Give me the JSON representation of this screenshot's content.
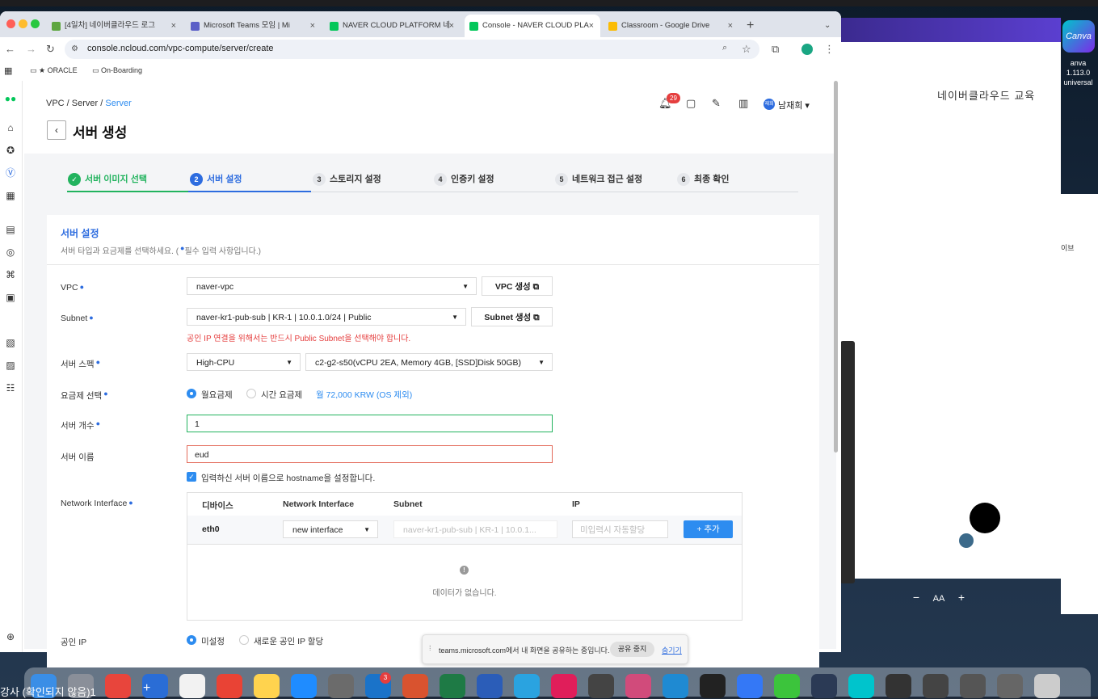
{
  "browser": {
    "tabs": [
      {
        "label": "[4일차] 네이버클라우드 로그",
        "color": "#5ea640"
      },
      {
        "label": "Microsoft Teams 모임 | Mi",
        "color": "#5b5fc7"
      },
      {
        "label": "NAVER CLOUD PLATFORM 네",
        "color": "#03c75a"
      },
      {
        "label": "Console - NAVER CLOUD PLA",
        "color": "#03c75a"
      },
      {
        "label": "Classroom - Google Drive",
        "color": "#fbbc04"
      }
    ],
    "url": "console.ncloud.com/vpc-compute/server/create",
    "bookmarks": [
      "★ ORACLE",
      "On-Boarding"
    ]
  },
  "header": {
    "breadcrumb": [
      "VPC",
      "Server",
      "Server"
    ],
    "title": "서버 생성",
    "notification_count": "29",
    "user_initial": "재희",
    "user_name": "남재희"
  },
  "steps": [
    {
      "num": "✓",
      "label": "서버 이미지 선택",
      "state": "done"
    },
    {
      "num": "2",
      "label": "서버 설정",
      "state": "active"
    },
    {
      "num": "3",
      "label": "스토리지 설정",
      "state": "todo"
    },
    {
      "num": "4",
      "label": "인증키 설정",
      "state": "todo"
    },
    {
      "num": "5",
      "label": "네트워크 접근 설정",
      "state": "todo"
    },
    {
      "num": "6",
      "label": "최종 확인",
      "state": "todo"
    }
  ],
  "section": {
    "title": "서버 설정",
    "desc": "서버 타입과 요금제를 선택하세요. (",
    "desc_req": "필수 입력 사항입니다.)"
  },
  "form": {
    "vpc": {
      "label": "VPC",
      "value": "naver-vpc",
      "button": "VPC 생성"
    },
    "subnet": {
      "label": "Subnet",
      "value": "naver-kr1-pub-sub | KR-1 | 10.0.1.0/24 | Public",
      "button": "Subnet 생성",
      "hint": "공인 IP 연결을 위해서는 반드시 Public Subnet을 선택해야 합니다."
    },
    "spec": {
      "label": "서버 스펙",
      "type": "High-CPU",
      "value": "c2-g2-s50(vCPU 2EA, Memory 4GB, [SSD]Disk 50GB)"
    },
    "billing": {
      "label": "요금제 선택",
      "monthly": "월요금제",
      "hourly": "시간 요금제",
      "price": "월 72,000 KRW (OS 제외)"
    },
    "count": {
      "label": "서버 개수",
      "value": "1"
    },
    "name": {
      "label": "서버 이름",
      "value": "eud"
    },
    "hostname_check": "입력하신 서버 이름으로 hostname을 설정합니다.",
    "network_interface": {
      "label": "Network Interface",
      "columns": [
        "디바이스",
        "Network Interface",
        "Subnet",
        "IP"
      ],
      "row": {
        "device": "eth0",
        "interface": "new interface",
        "subnet": "naver-kr1-pub-sub | KR-1 | 10.0.1...",
        "ip_placeholder": "미입력시 자동할당",
        "add_button": "+ 추가"
      },
      "empty": "데이터가 없습니다."
    },
    "public_ip": {
      "label": "공인 IP",
      "opt1": "미설정",
      "opt2": "새로운 공인 IP 할당"
    }
  },
  "share_bar": {
    "text": "teams.microsoft.com에서 내 화면을 공유하는 중입니다.",
    "stop": "공유 중지",
    "hide": "숨기기"
  },
  "side": {
    "title": "네이버클라우드 교육",
    "canva": "Canva",
    "canva_version": "anva 1.113.0 universal",
    "right_note": "이브"
  },
  "desktop": {
    "caption": "강사 (확인되지 않음)1",
    "dock_badge": "3"
  },
  "colors": {
    "primary": "#2d6cdf",
    "success": "#22b35e",
    "error": "#e53e3e",
    "link": "#2d8cf0"
  }
}
